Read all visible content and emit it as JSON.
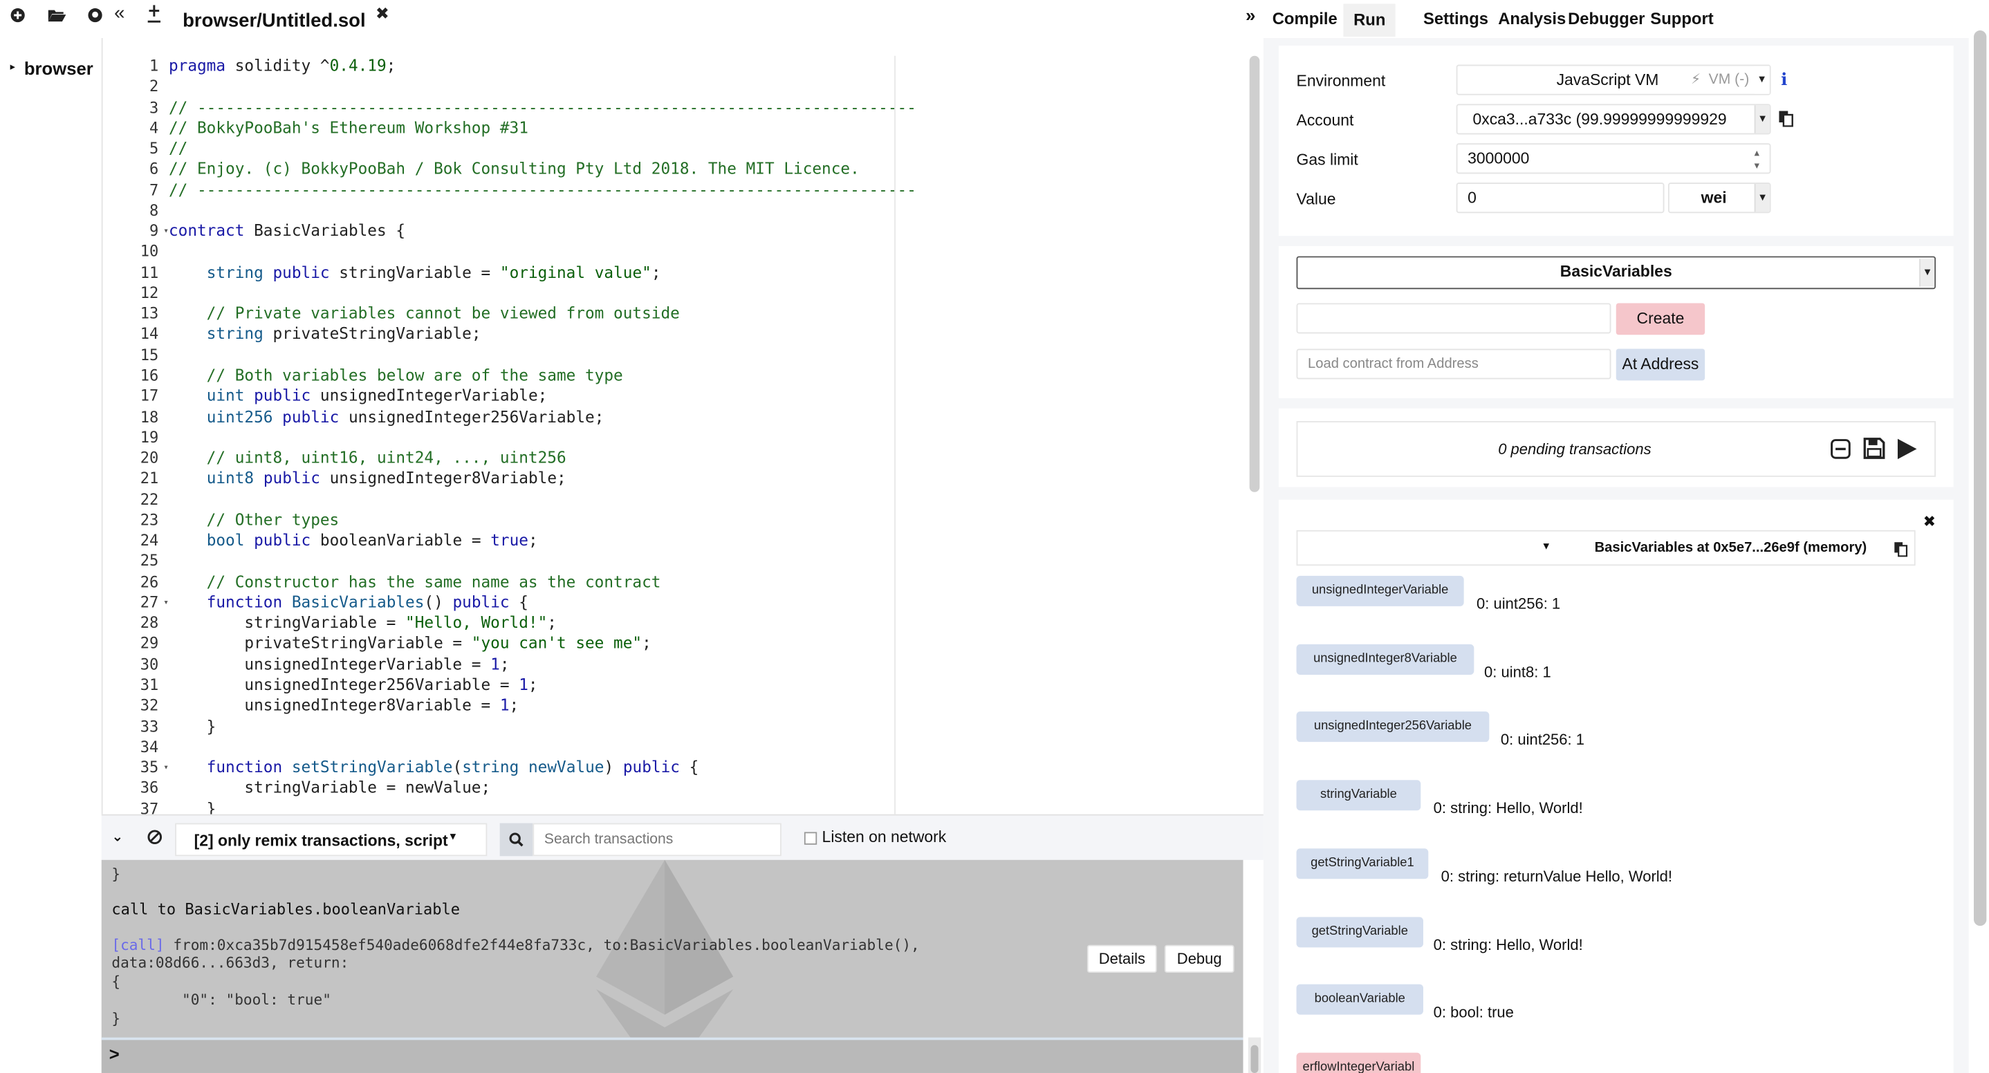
{
  "toolbar": {
    "icons": [
      "plus-icon",
      "folder-open-icon",
      "github-icon",
      "collapse-left-icon",
      "upload-icon"
    ],
    "file_tab": "browser/Untitled.sol",
    "close_glyph": "✖",
    "right_tabs": [
      "Compile",
      "Run",
      "Settings",
      "Analysis",
      "Debugger",
      "Support"
    ],
    "expand_glyph": "»"
  },
  "file_explorer": {
    "root": "browser"
  },
  "editor": {
    "line_numbers": [
      "1",
      "2",
      "3",
      "4",
      "5",
      "6",
      "7",
      "8",
      "9",
      "10",
      "11",
      "12",
      "13",
      "14",
      "15",
      "16",
      "17",
      "18",
      "19",
      "20",
      "21",
      "22",
      "23",
      "24",
      "25",
      "26",
      "27",
      "28",
      "29",
      "30",
      "31",
      "32",
      "33",
      "34",
      "35",
      "36",
      "37"
    ],
    "folded_lines": [
      9,
      27,
      35
    ]
  },
  "terminal_bar": {
    "filter": "[2] only remix transactions, script",
    "search_placeholder": "Search transactions",
    "listen_label": "Listen on network"
  },
  "terminal": {
    "brace_close_1": "}",
    "call_title": "call to BasicVariables.booleanVariable",
    "call_tag": "[call]",
    "call_detail_1": " from:0xca35b7d915458ef540ade6068dfe2f44e8fa733c, to:BasicVariables.booleanVariable(),",
    "call_detail_2": "data:08d66...663d3, return:",
    "brace_open": "{",
    "return_value": "        \"0\": \"bool: true\"",
    "brace_close_2": "}",
    "details_button": "Details",
    "debug_button": "Debug",
    "prompt": ">"
  },
  "run_panel": {
    "environment_label": "Environment",
    "environment_value": "JavaScript VM",
    "environment_vm": "VM (-)",
    "account_label": "Account",
    "account_value": "0xca3...a733c (99.99999999999929",
    "gas_label": "Gas limit",
    "gas_value": "3000000",
    "value_label": "Value",
    "value_value": "0",
    "value_unit": "wei",
    "contract_select": "BasicVariables",
    "create_button": "Create",
    "address_placeholder": "Load contract from Address",
    "at_address_button": "At Address",
    "pending": "0 pending transactions",
    "instance_title": "BasicVariables at 0x5e7...26e9f (memory)"
  },
  "instance_functions": [
    {
      "name": "unsignedIntegerVariable",
      "result": "0: uint256: 1"
    },
    {
      "name": "unsignedInteger8Variable",
      "result": "0: uint8: 1"
    },
    {
      "name": "unsignedInteger256Variable",
      "result": "0: uint256: 1"
    },
    {
      "name": "stringVariable",
      "result": "0: string: Hello, World!"
    },
    {
      "name": "getStringVariable1",
      "result": "0: string: returnValue Hello, World!"
    },
    {
      "name": "getStringVariable",
      "result": "0: string: Hello, World!"
    },
    {
      "name": "booleanVariable",
      "result": "0: bool: true"
    },
    {
      "name": "erflowIntegerVariabl",
      "result": ""
    }
  ],
  "colors": {
    "create_button": "#f5c6cb",
    "function_button": "#d5dfef",
    "terminal_bg": "#c4c4c4",
    "comment": "#236e25",
    "keyword": "#1a1aa6"
  }
}
